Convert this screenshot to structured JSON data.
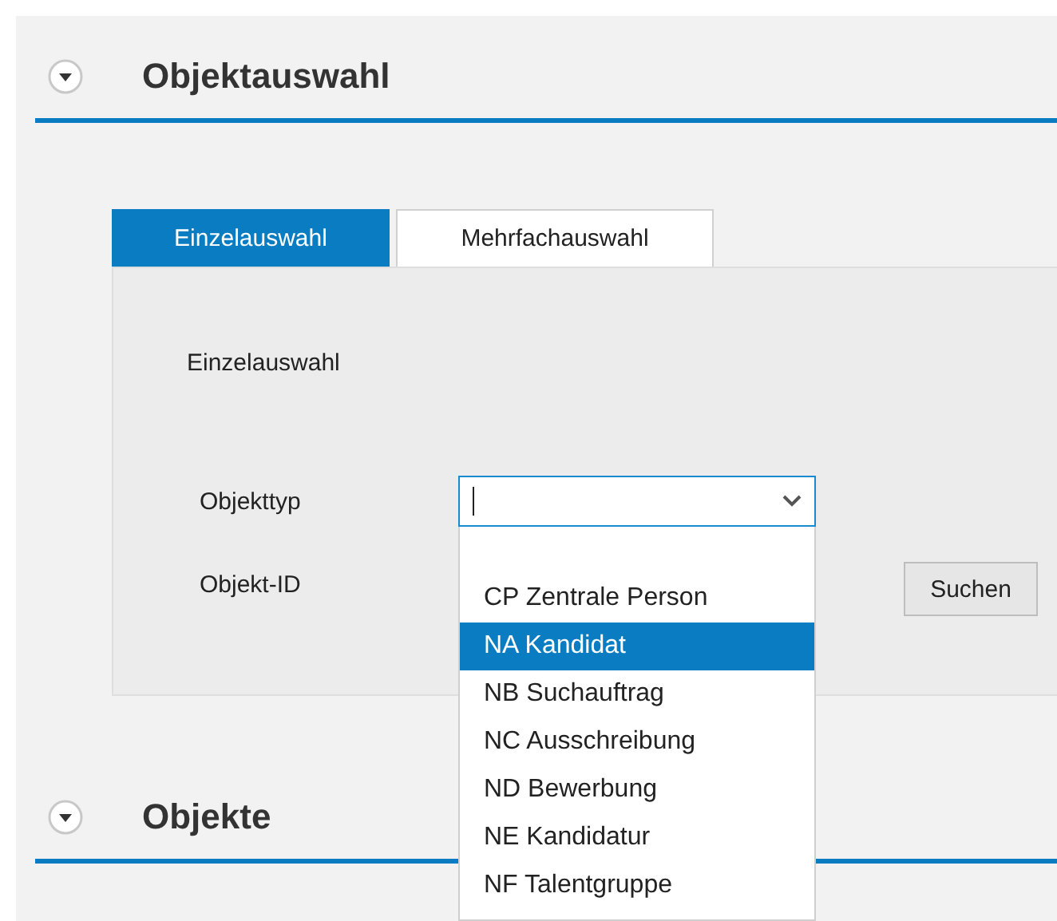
{
  "sections": [
    {
      "title": "Objektauswahl"
    },
    {
      "title": "Objekte"
    }
  ],
  "tabs": [
    {
      "label": "Einzelauswahl",
      "selected": true
    },
    {
      "label": "Mehrfachauswahl",
      "selected": false
    }
  ],
  "panel": {
    "heading": "Einzelauswahl",
    "object_type_label": "Objekttyp",
    "object_id_label": "Objekt-ID",
    "search_button": "Suchen"
  },
  "dropdown": {
    "options": [
      {
        "label": "CP Zentrale Person",
        "selected": false
      },
      {
        "label": "NA Kandidat",
        "selected": true
      },
      {
        "label": "NB Suchauftrag",
        "selected": false
      },
      {
        "label": "NC Ausschreibung",
        "selected": false
      },
      {
        "label": "ND Bewerbung",
        "selected": false
      },
      {
        "label": "NE Kandidatur",
        "selected": false
      },
      {
        "label": "NF Talentgruppe",
        "selected": false
      }
    ]
  }
}
